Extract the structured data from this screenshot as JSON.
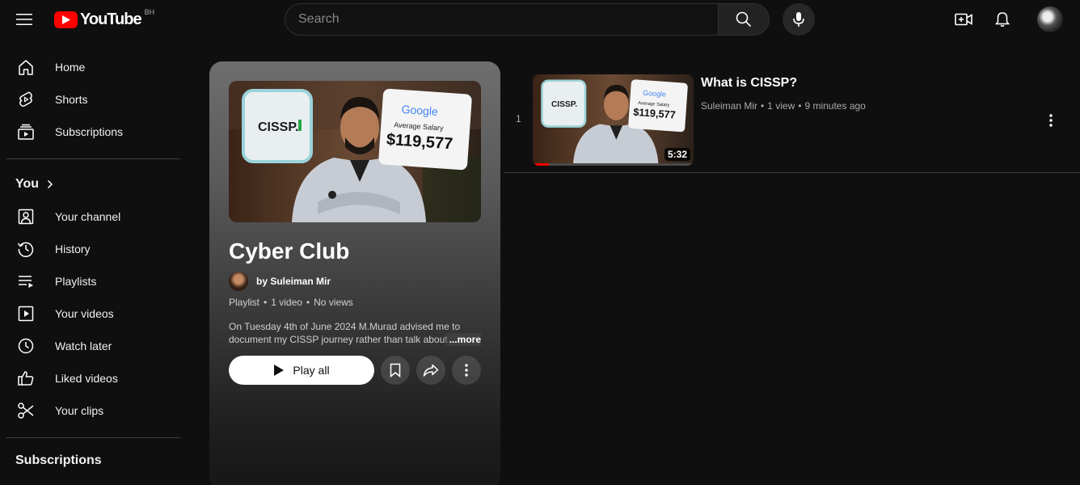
{
  "header": {
    "logo_text": "YouTube",
    "country_code": "BH",
    "search_placeholder": "Search"
  },
  "sidebar": {
    "main_items": [
      {
        "label": "Home",
        "icon": "home-icon"
      },
      {
        "label": "Shorts",
        "icon": "shorts-icon"
      },
      {
        "label": "Subscriptions",
        "icon": "subscriptions-icon"
      }
    ],
    "you_heading": "You",
    "you_items": [
      {
        "label": "Your channel",
        "icon": "your-channel-icon"
      },
      {
        "label": "History",
        "icon": "history-icon"
      },
      {
        "label": "Playlists",
        "icon": "playlists-icon"
      },
      {
        "label": "Your videos",
        "icon": "your-videos-icon"
      },
      {
        "label": "Watch later",
        "icon": "clock-icon"
      },
      {
        "label": "Liked videos",
        "icon": "thumbs-up-icon"
      },
      {
        "label": "Your clips",
        "icon": "scissors-icon"
      }
    ],
    "subscriptions_heading": "Subscriptions"
  },
  "playlist": {
    "title": "Cyber Club",
    "owner": "by Suleiman Mir",
    "type": "Playlist",
    "video_count": "1 video",
    "views": "No views",
    "description": "On Tuesday 4th of June 2024 M.Murad advised me to document my CISSP journey rather than talk about",
    "more_label": "...more",
    "play_all_label": "Play all",
    "thumbnail_texts": {
      "badge": "CISSP.",
      "brand": "Google",
      "caption": "Average Salary",
      "amount": "$119,577"
    }
  },
  "videos": [
    {
      "index": "1",
      "title": "What is CISSP?",
      "channel": "Suleiman Mir",
      "views": "1 view",
      "age": "9 minutes ago",
      "duration": "5:32",
      "watched_fraction": 0.1
    }
  ],
  "colors": {
    "brand_red": "#ff0000",
    "background": "#0f0f0f"
  }
}
